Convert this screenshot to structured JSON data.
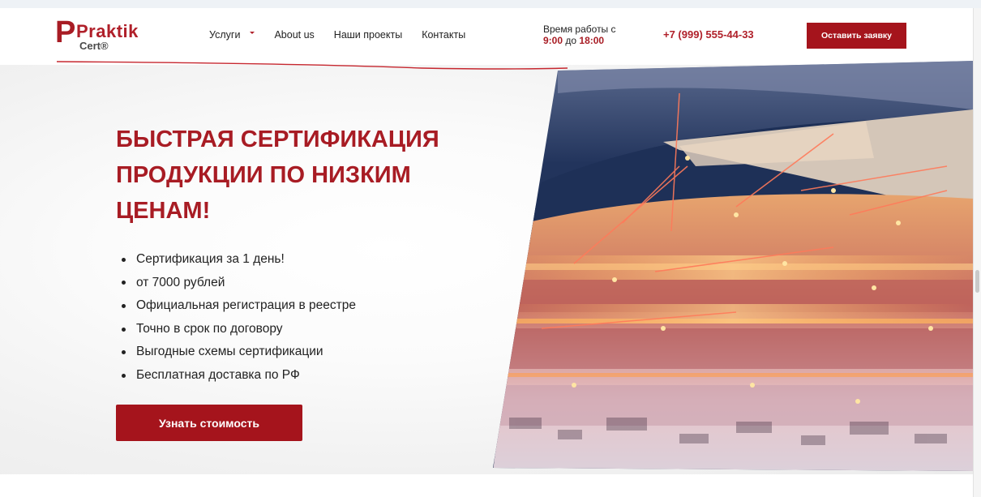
{
  "header": {
    "logo": {
      "main": "Praktik",
      "sub": "Cert®"
    },
    "nav": [
      {
        "label": "Услуги",
        "has_dropdown": true
      },
      {
        "label": "About us"
      },
      {
        "label": "Наши проекты"
      },
      {
        "label": "Контакты"
      }
    ],
    "hours": {
      "line1": "Время работы с",
      "from": "9:00",
      "to_word": "до",
      "to": "18:00"
    },
    "phone": "+7 (999) 555-44-33",
    "cta_label": "Оставить заявку"
  },
  "hero": {
    "title": "БЫСТРАЯ СЕРТИФИКАЦИЯ ПРОДУКЦИИ ПО НИЗКИМ ЦЕНАМ!",
    "features": [
      "Сертификация за 1 день!",
      "от 7000 рублей",
      "Официальная регистрация в реестре",
      "Точно в срок по договору",
      "Выгодные схемы сертификации",
      "Бесплатная доставка по РФ"
    ],
    "cta_label": "Узнать стоимость",
    "image_icon": "industrial-port-photo"
  },
  "colors": {
    "accent": "#a5141c",
    "brand_red": "#a81c24"
  }
}
